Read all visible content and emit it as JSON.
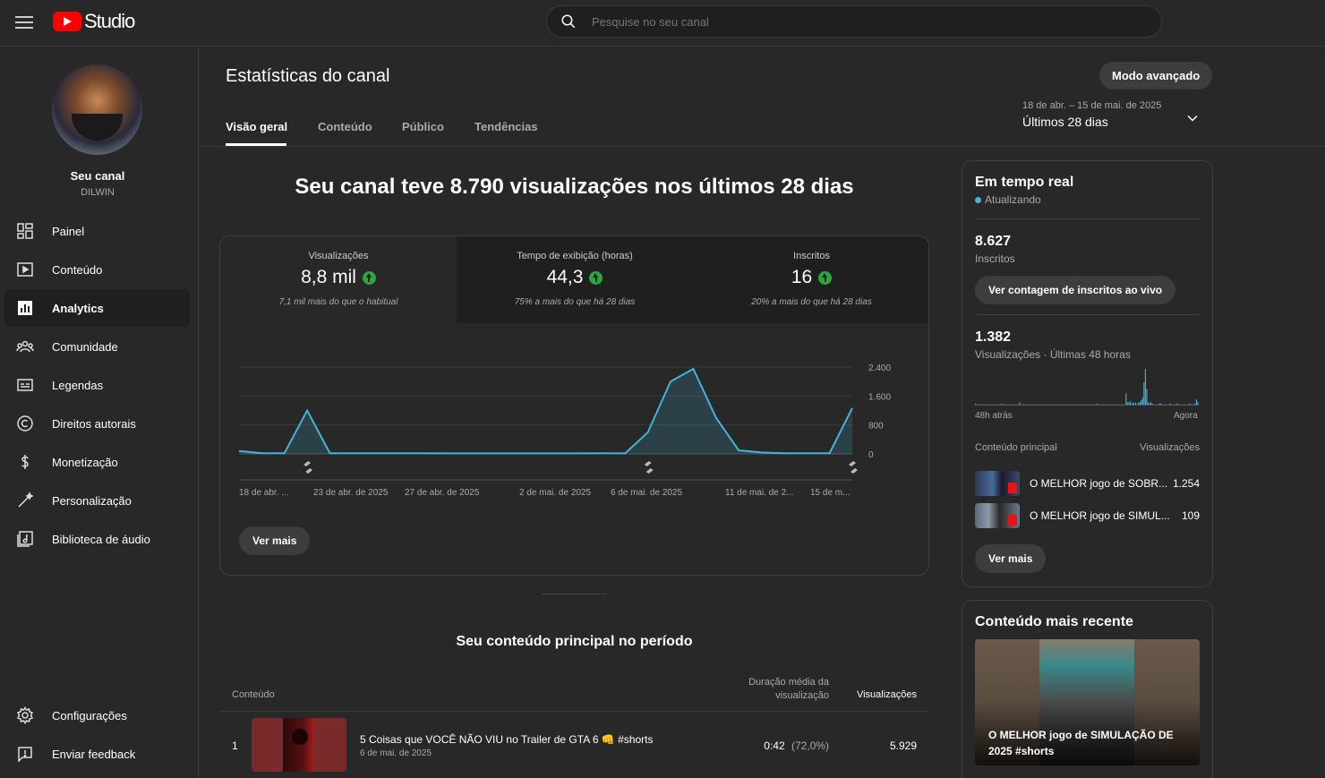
{
  "header": {
    "logo_text": "Studio",
    "search_placeholder": "Pesquise no seu canal"
  },
  "sidebar": {
    "channel_label": "Seu canal",
    "channel_name": "DILWIN",
    "items": [
      {
        "label": "Painel",
        "icon": "dashboard-icon"
      },
      {
        "label": "Conteúdo",
        "icon": "content-icon"
      },
      {
        "label": "Analytics",
        "icon": "analytics-icon",
        "active": true
      },
      {
        "label": "Comunidade",
        "icon": "community-icon"
      },
      {
        "label": "Legendas",
        "icon": "subtitles-icon"
      },
      {
        "label": "Direitos autorais",
        "icon": "copyright-icon"
      },
      {
        "label": "Monetização",
        "icon": "monetization-icon"
      },
      {
        "label": "Personalização",
        "icon": "customization-icon"
      },
      {
        "label": "Biblioteca de áudio",
        "icon": "audio-library-icon"
      }
    ],
    "bottom_items": [
      {
        "label": "Configurações",
        "icon": "settings-icon"
      },
      {
        "label": "Enviar feedback",
        "icon": "feedback-icon"
      }
    ]
  },
  "page": {
    "title": "Estatísticas do canal",
    "advanced_button": "Modo avançado",
    "tabs": [
      "Visão geral",
      "Conteúdo",
      "Público",
      "Tendências"
    ],
    "date_range": "18 de abr. – 15 de mai. de 2025",
    "range_label": "Últimos 28 dias"
  },
  "overview": {
    "headline": "Seu canal teve 8.790 visualizações nos últimos 28 dias",
    "kpis": [
      {
        "label": "Visualizações",
        "value": "8,8 mil",
        "note": "7,1 mil mais do que o habitual"
      },
      {
        "label": "Tempo de exibição (horas)",
        "value": "44,3",
        "note": "75% a mais do que há 28 dias"
      },
      {
        "label": "Inscritos",
        "value": "16",
        "note": "20% a mais do que há 28 dias"
      }
    ],
    "see_more": "Ver mais"
  },
  "chart_data": {
    "type": "area",
    "x": [
      "18 de abr.",
      "19",
      "20",
      "21",
      "22",
      "23",
      "24",
      "25",
      "26",
      "27",
      "28",
      "29",
      "30",
      "1",
      "2",
      "3",
      "4",
      "5",
      "6",
      "7",
      "8",
      "9",
      "10",
      "11",
      "12",
      "13",
      "14",
      "15"
    ],
    "x_tick_labels": [
      "18 de abr. ...",
      "23 de abr. de 2025",
      "27 de abr. de 2025",
      "2 de mai. de 2025",
      "6 de mai. de 2025",
      "11 de mai. de 2...",
      "15 de m..."
    ],
    "y_tick_labels": [
      "0",
      "800",
      "1.600",
      "2.400"
    ],
    "ylim": [
      0,
      2400
    ],
    "series": [
      {
        "values": [
          80,
          20,
          20,
          1200,
          20,
          20,
          20,
          20,
          20,
          15,
          15,
          15,
          15,
          15,
          15,
          15,
          20,
          15,
          600,
          2000,
          2350,
          1000,
          100,
          40,
          20,
          20,
          20,
          1270
        ]
      }
    ],
    "color": "#41b4d9",
    "grid": true
  },
  "top_content": {
    "title": "Seu conteúdo principal no período",
    "col_content": "Conteúdo",
    "col_duration": "Duração média da visualização",
    "col_views": "Visualizações",
    "rows": [
      {
        "rank": "1",
        "title": "5 Coisas que VOCÊ NÃO VIU no Trailer de GTA 6 👊 #shorts",
        "date": "6 de mai. de 2025",
        "duration": "0:42",
        "pct": "(72,0%)",
        "views": "5.929"
      }
    ]
  },
  "realtime": {
    "title": "Em tempo real",
    "status": "Atualizando",
    "subs_value": "8.627",
    "subs_label": "Inscritos",
    "live_button": "Ver contagem de inscritos ao vivo",
    "views_value": "1.382",
    "views_label": "Visualizações · Últimas 48 horas",
    "x_start": "48h atrás",
    "x_end": "Agora",
    "bars": [
      1,
      0,
      0,
      0,
      0,
      0,
      0,
      0,
      0,
      0,
      0,
      0,
      0,
      0,
      0,
      0,
      0,
      0,
      0,
      1,
      0,
      0,
      0,
      0,
      0,
      0,
      0,
      0,
      0,
      0,
      0,
      0,
      2,
      0,
      0,
      0,
      0,
      0,
      0,
      0,
      0,
      0,
      0,
      0,
      0,
      0,
      0,
      0,
      0,
      0,
      0,
      0,
      0,
      0,
      0,
      0,
      0,
      0,
      0,
      0,
      0,
      0,
      0,
      0,
      0,
      0,
      0,
      0,
      0,
      0,
      0,
      0,
      0,
      0,
      0,
      0,
      0,
      0,
      0,
      0,
      0,
      0,
      0,
      0,
      0,
      0,
      0,
      0,
      1,
      0,
      0,
      0,
      0,
      0,
      0,
      0,
      0,
      0,
      0,
      0,
      0,
      0,
      0,
      0,
      0,
      0,
      0,
      0,
      0,
      10,
      2,
      2,
      3,
      1,
      2,
      1,
      2,
      0,
      2,
      2,
      4,
      6,
      20,
      32,
      14,
      2,
      1,
      2,
      1,
      0,
      0,
      0,
      0,
      1,
      1,
      0,
      0,
      0,
      0,
      0,
      0,
      1,
      0,
      0,
      0,
      0,
      1,
      0,
      0,
      0,
      0,
      0,
      0,
      0,
      0,
      1,
      0,
      0,
      0,
      1,
      5,
      2
    ],
    "top_label": "Conteúdo principal",
    "views_col": "Visualizações",
    "items": [
      {
        "title": "O MELHOR jogo de SOBR...",
        "views": "1.254"
      },
      {
        "title": "O MELHOR jogo de SIMUL...",
        "views": "109"
      }
    ],
    "see_more": "Ver mais"
  },
  "recent": {
    "title": "Conteúdo mais recente",
    "video_title": "O MELHOR jogo de SIMULAÇÃO DE 2025 #shorts"
  }
}
